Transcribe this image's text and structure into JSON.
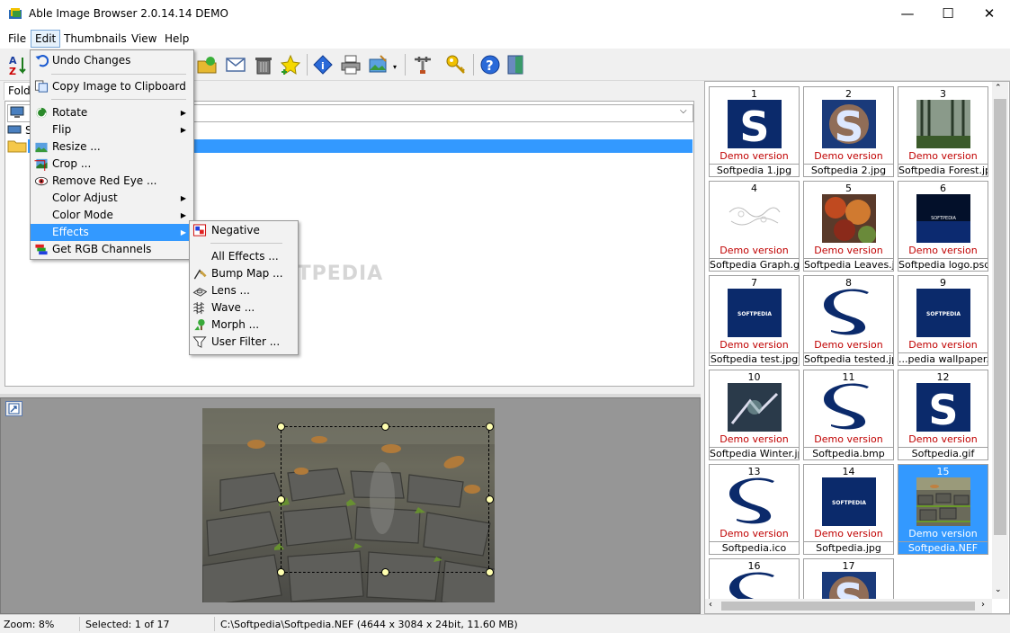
{
  "window": {
    "title": "Able Image Browser 2.0.14.14 DEMO",
    "minimize": "—",
    "maximize": "☐",
    "close": "✕"
  },
  "menubar": [
    "File",
    "Edit",
    "Thumbnails",
    "View",
    "Help"
  ],
  "folder_tab": "Folde",
  "tree_root_label": "S",
  "edit_menu": [
    {
      "label": "Undo Changes",
      "icon": "undo-icon"
    },
    {
      "label": "Copy Image to Clipboard",
      "icon": "copy-icon"
    },
    {
      "label": "Rotate",
      "icon": "rotate-icon",
      "submenu": true
    },
    {
      "label": "Flip",
      "submenu": true
    },
    {
      "label": "Resize ...",
      "icon": "resize-icon"
    },
    {
      "label": "Crop ...",
      "icon": "crop-icon"
    },
    {
      "label": "Remove Red Eye ...",
      "icon": "eye-icon"
    },
    {
      "label": "Color Adjust",
      "submenu": true
    },
    {
      "label": "Color Mode",
      "submenu": true
    },
    {
      "label": "Effects",
      "submenu": true,
      "highlighted": true
    },
    {
      "label": "Get RGB Channels",
      "icon": "rgb-icon"
    }
  ],
  "effects_menu": [
    {
      "label": "Negative",
      "icon": "negative-icon"
    },
    {
      "label": "All Effects ..."
    },
    {
      "label": "Bump Map ...",
      "icon": "bump-map-icon"
    },
    {
      "label": "Lens ...",
      "icon": "lens-icon"
    },
    {
      "label": "Wave ...",
      "icon": "wave-icon"
    },
    {
      "label": "Morph ...",
      "icon": "morph-icon"
    },
    {
      "label": "User Filter ...",
      "icon": "funnel-icon"
    }
  ],
  "watermark": "SOFTPEDIA",
  "thumbnails": [
    {
      "num": "1",
      "demo": "Demo version",
      "name": "Softpedia 1.jpg",
      "kind": "s"
    },
    {
      "num": "2",
      "demo": "Demo version",
      "name": "Softpedia 2.jpg",
      "kind": "s2"
    },
    {
      "num": "3",
      "demo": "Demo version",
      "name": "Softpedia Forest.jpg",
      "kind": "forest"
    },
    {
      "num": "4",
      "demo": "Demo version",
      "name": "Softpedia Graph.gif",
      "kind": "graph"
    },
    {
      "num": "5",
      "demo": "Demo version",
      "name": "Softpedia Leaves.jpg",
      "kind": "leaves"
    },
    {
      "num": "6",
      "demo": "Demo version",
      "name": "Softpedia logo.psd",
      "kind": "logo"
    },
    {
      "num": "7",
      "demo": "Demo version",
      "name": "Softpedia test.jpg",
      "kind": "box"
    },
    {
      "num": "8",
      "demo": "Demo version",
      "name": "Softpedia tested.jpg",
      "kind": "bigs"
    },
    {
      "num": "9",
      "demo": "Demo version",
      "name": "...pedia wallpaper.jpg",
      "kind": "box"
    },
    {
      "num": "10",
      "demo": "Demo version",
      "name": "Softpedia Winter.jpg",
      "kind": "winter"
    },
    {
      "num": "11",
      "demo": "Demo version",
      "name": "Softpedia.bmp",
      "kind": "bigs"
    },
    {
      "num": "12",
      "demo": "Demo version",
      "name": "Softpedia.gif",
      "kind": "s"
    },
    {
      "num": "13",
      "demo": "Demo version",
      "name": "Softpedia.ico",
      "kind": "bigs"
    },
    {
      "num": "14",
      "demo": "Demo version",
      "name": "Softpedia.jpg",
      "kind": "box"
    },
    {
      "num": "15",
      "demo": "Demo version",
      "name": "Softpedia.NEF",
      "kind": "road",
      "selected": true
    },
    {
      "num": "16",
      "demo": "",
      "name": "",
      "kind": "bigs"
    },
    {
      "num": "17",
      "demo": "",
      "name": "",
      "kind": "s2"
    }
  ],
  "thumb_logo_text": "SOFTPEDIA",
  "status": {
    "zoom": "Zoom: 8%",
    "selected": "Selected: 1 of 17",
    "file": "C:\\Softpedia\\Softpedia.NEF (4644 x 3084 x 24bit, 11.60 MB)"
  },
  "colors": {
    "highlight": "#3399ff",
    "demo_text": "#c00000",
    "softpedia_blue": "#0b2a6b"
  }
}
